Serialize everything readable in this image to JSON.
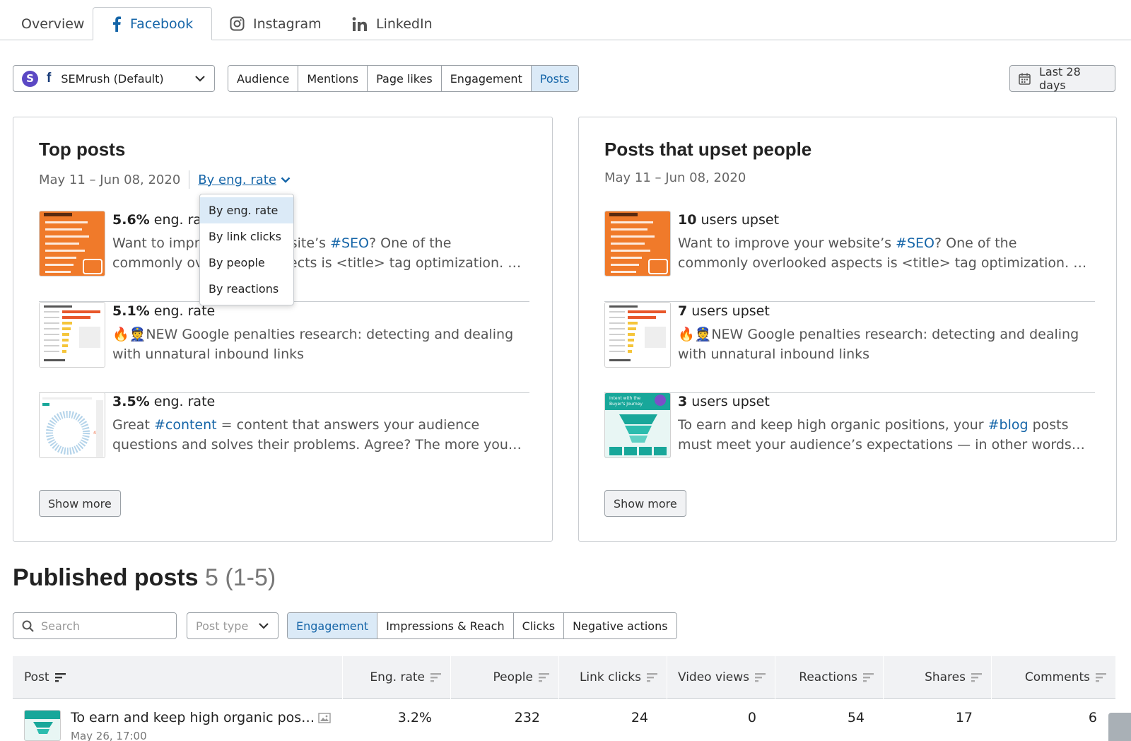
{
  "top_tabs": {
    "overview": "Overview",
    "facebook": "Facebook",
    "instagram": "Instagram",
    "linkedin": "LinkedIn"
  },
  "account": {
    "avatar_letter": "S",
    "fb_letter": "f",
    "name": "SEMrush (Default)"
  },
  "section_tabs": [
    "Audience",
    "Mentions",
    "Page likes",
    "Engagement",
    "Posts"
  ],
  "date_range_button": "Last 28 days",
  "top_posts": {
    "title": "Top posts",
    "date_range": "May 11 – Jun 08, 2020",
    "sort_label": "By eng. rate",
    "dropdown": [
      "By eng. rate",
      "By link clicks",
      "By people",
      "By reactions"
    ],
    "posts": [
      {
        "value": "5.6%",
        "unit": "eng. rate",
        "pre": "Want to improve your website’s ",
        "tag": "#SEO",
        "post": "? One of the commonly overlooked aspects is <title> tag optimization. If you can learn how to write the right title."
      },
      {
        "value": "5.1%",
        "unit": "eng. rate",
        "pre": "🔥👮NEW Google penalties research: detecting and dealing with unnatural inbound links",
        "tag": "",
        "post": ""
      },
      {
        "value": "3.5%",
        "unit": "eng. rate",
        "pre": "Great ",
        "tag": "#content",
        "post": " = content that answers your audience questions and solves their problems. Agree? The more you know about your audience."
      }
    ],
    "show_more": "Show more"
  },
  "upset_posts": {
    "title": "Posts that upset people",
    "date_range": "May 11 – Jun 08, 2020",
    "posts": [
      {
        "value": "10",
        "unit": "users upset",
        "pre": "Want to improve your website’s ",
        "tag": "#SEO",
        "post": "? One of the commonly overlooked aspects is <title> tag optimization. If you can learn how to write the right title."
      },
      {
        "value": "7",
        "unit": "users upset",
        "pre": "🔥👮NEW Google penalties research: detecting and dealing with unnatural inbound links",
        "tag": "",
        "post": ""
      },
      {
        "value": "3",
        "unit": "users upset",
        "pre": "To earn and keep high organic positions, your ",
        "tag": "#blog",
        "post": " posts must meet your audience’s expectations — in other words, they must satisfy search intent."
      }
    ],
    "show_more": "Show more"
  },
  "published": {
    "title": "Published posts",
    "count": "5 (1-5)",
    "search_placeholder": "Search",
    "post_type_placeholder": "Post type",
    "metric_tabs": [
      "Engagement",
      "Impressions & Reach",
      "Clicks",
      "Negative actions"
    ],
    "columns": [
      "Post",
      "Eng. rate",
      "People",
      "Link clicks",
      "Video views",
      "Reactions",
      "Shares",
      "Comments"
    ],
    "rows": [
      {
        "title": "To earn and keep high organic pos…",
        "date": "May 26, 17:00",
        "eng_rate": "3.2%",
        "people": "232",
        "link_clicks": "24",
        "video_views": "0",
        "reactions": "54",
        "shares": "17",
        "comments": "6"
      }
    ]
  },
  "colors": {
    "accent": "#1565a8",
    "active_bg": "#dbeaf7",
    "brand_purple": "#5b48c4",
    "thumb_orange": "#f07a2a",
    "thumb_teal": "#18a79a"
  }
}
